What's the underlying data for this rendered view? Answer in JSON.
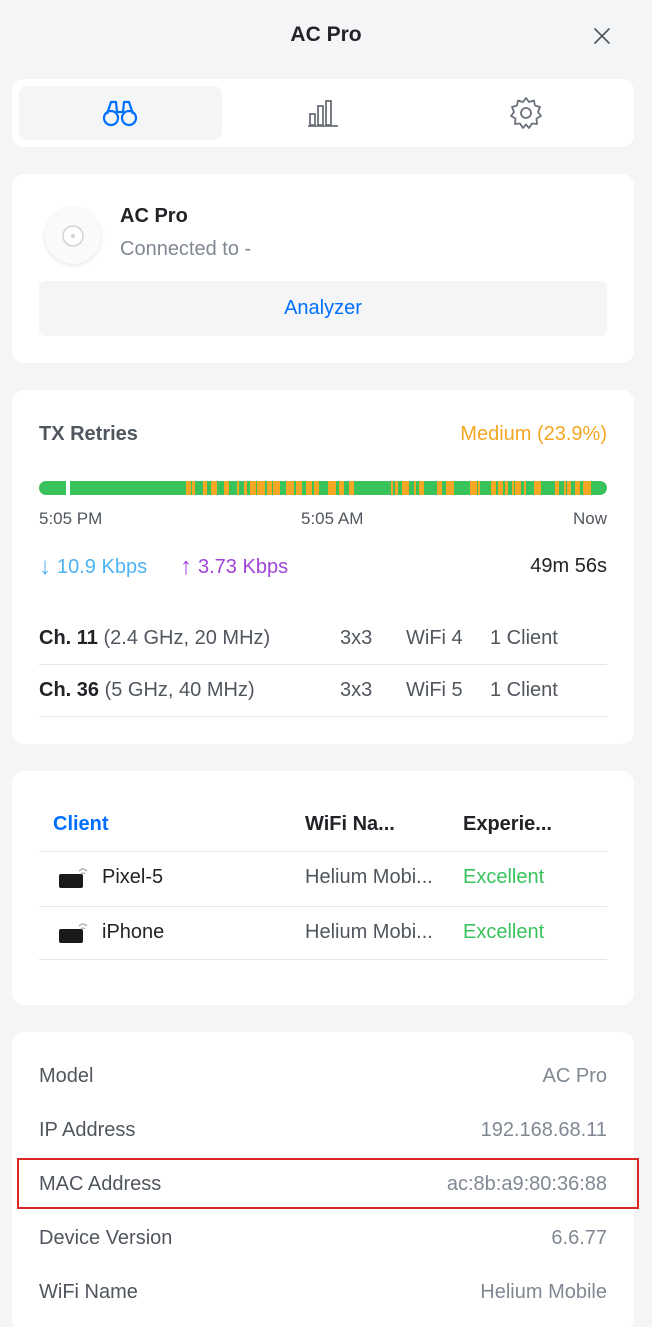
{
  "header": {
    "title": "AC Pro"
  },
  "tabs": [
    {
      "icon": "binoculars-icon",
      "active": true
    },
    {
      "icon": "bar-chart-icon",
      "active": false
    },
    {
      "icon": "gear-icon",
      "active": false
    }
  ],
  "device": {
    "name": "AC Pro",
    "connected": "Connected to -",
    "analyzer_label": "Analyzer"
  },
  "stats": {
    "tx_label": "TX Retries",
    "tx_value": "Medium (23.9%)",
    "tx_retry_fraction": 0.239,
    "time_start": "5:05 PM",
    "time_mid": "5:05 AM",
    "time_end": "Now",
    "down_rate": "10.9 Kbps",
    "up_rate": "3.73 Kbps",
    "uptime": "49m 56s",
    "channels": [
      {
        "channel": "Ch. 11",
        "band": " (2.4 GHz, 20 MHz)",
        "mimo": "3x3",
        "wifi": "WiFi 4",
        "clients": "1 Client"
      },
      {
        "channel": "Ch. 36",
        "band": " (5 GHz, 40 MHz)",
        "mimo": "3x3",
        "wifi": "WiFi 5",
        "clients": "1 Client"
      }
    ]
  },
  "clients": {
    "headers": {
      "client": "Client",
      "wifi": "WiFi Na...",
      "experience": "Experie..."
    },
    "rows": [
      {
        "name": "Pixel-5",
        "wifi": "Helium Mobi...",
        "experience": "Excellent"
      },
      {
        "name": "iPhone",
        "wifi": "Helium Mobi...",
        "experience": "Excellent"
      }
    ]
  },
  "info": [
    {
      "label": "Model",
      "value": "AC Pro"
    },
    {
      "label": "IP Address",
      "value": "192.168.68.11"
    },
    {
      "label": "MAC Address",
      "value": "ac:8b:a9:80:36:88"
    },
    {
      "label": "Device Version",
      "value": "6.6.77"
    },
    {
      "label": "WiFi Name",
      "value": "Helium Mobile"
    }
  ],
  "colors": {
    "accent": "#006fff",
    "good": "#39c35c",
    "warn": "#f5a623",
    "download": "#4cb3f5",
    "upload": "#a142d8",
    "highlight": "#dc2626"
  }
}
